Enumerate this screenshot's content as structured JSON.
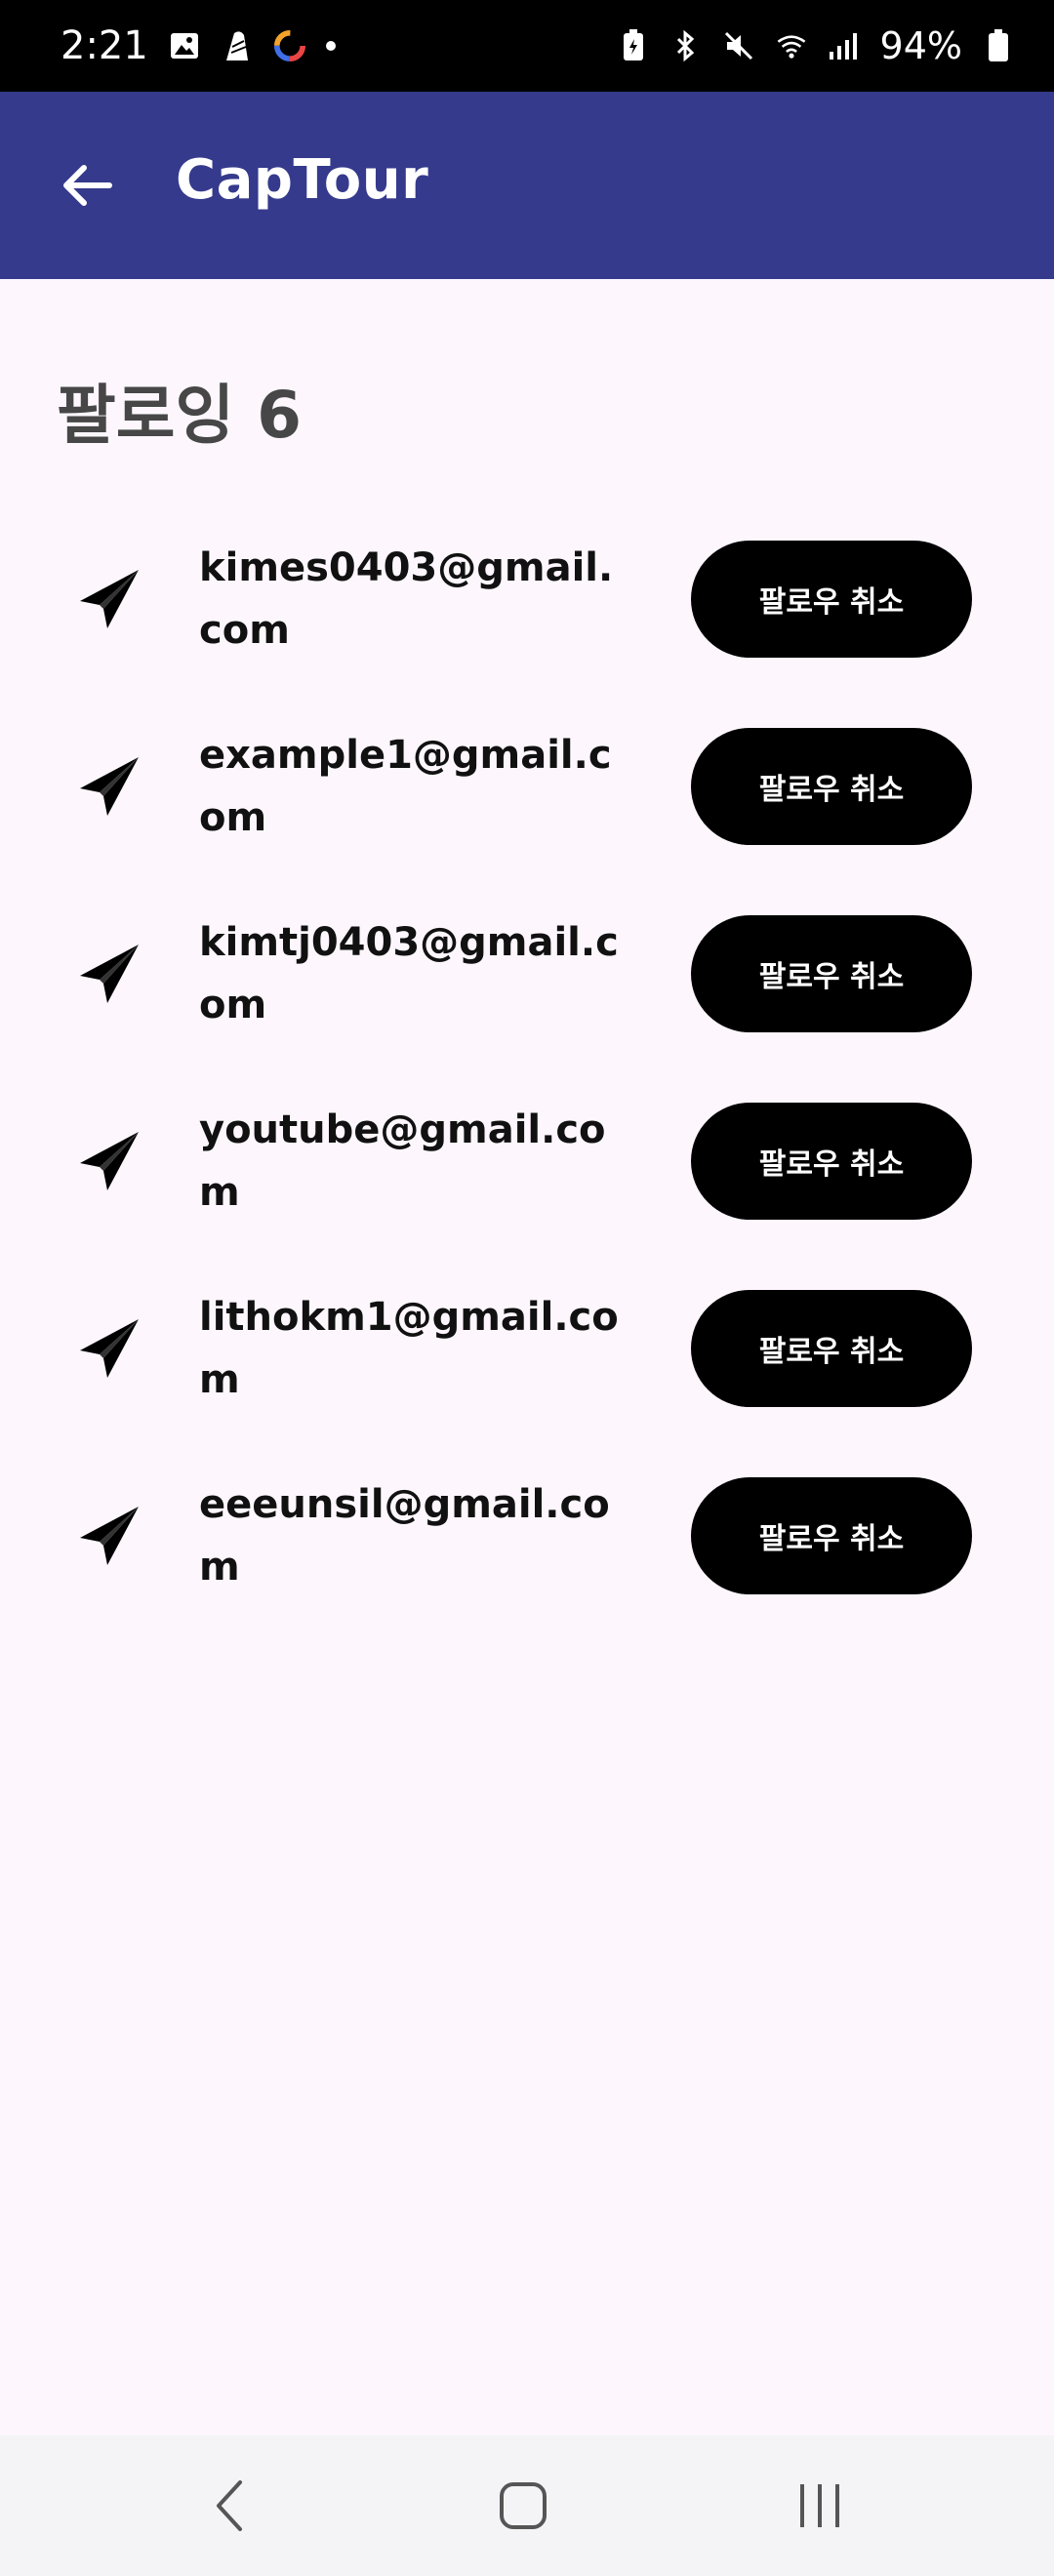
{
  "status_bar": {
    "time": "2:21",
    "battery_percent": "94%"
  },
  "app_bar": {
    "title": "CapTour"
  },
  "section": {
    "title": "팔로잉 6"
  },
  "following": [
    {
      "email": "kimes0403@gmail.com",
      "button_label": "팔로우 취소"
    },
    {
      "email": "example1@gmail.com",
      "button_label": "팔로우 취소"
    },
    {
      "email": "kimtj0403@gmail.com",
      "button_label": "팔로우 취소"
    },
    {
      "email": "youtube@gmail.com",
      "button_label": "팔로우 취소"
    },
    {
      "email": "lithokm1@gmail.com",
      "button_label": "팔로우 취소"
    },
    {
      "email": "eeeunsil@gmail.com",
      "button_label": "팔로우 취소"
    }
  ],
  "colors": {
    "app_bar": "#353a8c",
    "background": "#fdf7fd",
    "button": "#000000"
  },
  "icons": {
    "back": "arrow-back-icon",
    "item": "paper-plane-icon",
    "nav": [
      "nav-back-icon",
      "nav-home-icon",
      "nav-recents-icon"
    ]
  }
}
